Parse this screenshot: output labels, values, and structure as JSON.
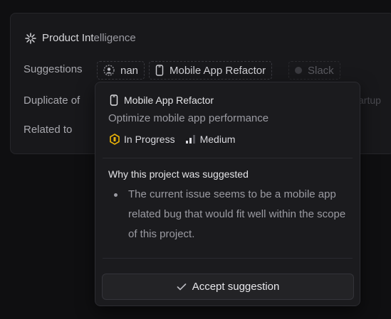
{
  "panel": {
    "title_prefix": "Product Int",
    "title_suffix": "elligence",
    "icon": "sparkle-icon"
  },
  "rows": {
    "suggestions_label": "Suggestions",
    "duplicate_label": "Duplicate of",
    "related_label": "Related to"
  },
  "chips": {
    "assignee": {
      "label": "nan",
      "icon": "avatar-icon"
    },
    "project": {
      "label": "Mobile App Refactor",
      "icon": "phone-icon"
    },
    "integration": {
      "label": "Slack",
      "icon": "dot-icon"
    },
    "faint_right": "artup"
  },
  "popover": {
    "title": "Mobile App Refactor",
    "title_icon": "phone-icon",
    "description": "Optimize mobile app performance",
    "status": {
      "label": "In Progress",
      "color": "#eab308",
      "icon": "in-progress-icon"
    },
    "priority": {
      "label": "Medium",
      "icon": "signal-bars-icon"
    },
    "why_title": "Why this project was suggested",
    "reasons": [
      "The current issue seems to be a mobile app related bug that would fit well within the scope of this project."
    ],
    "accept_label": "Accept suggestion",
    "accept_icon": "checkmark-icon"
  }
}
